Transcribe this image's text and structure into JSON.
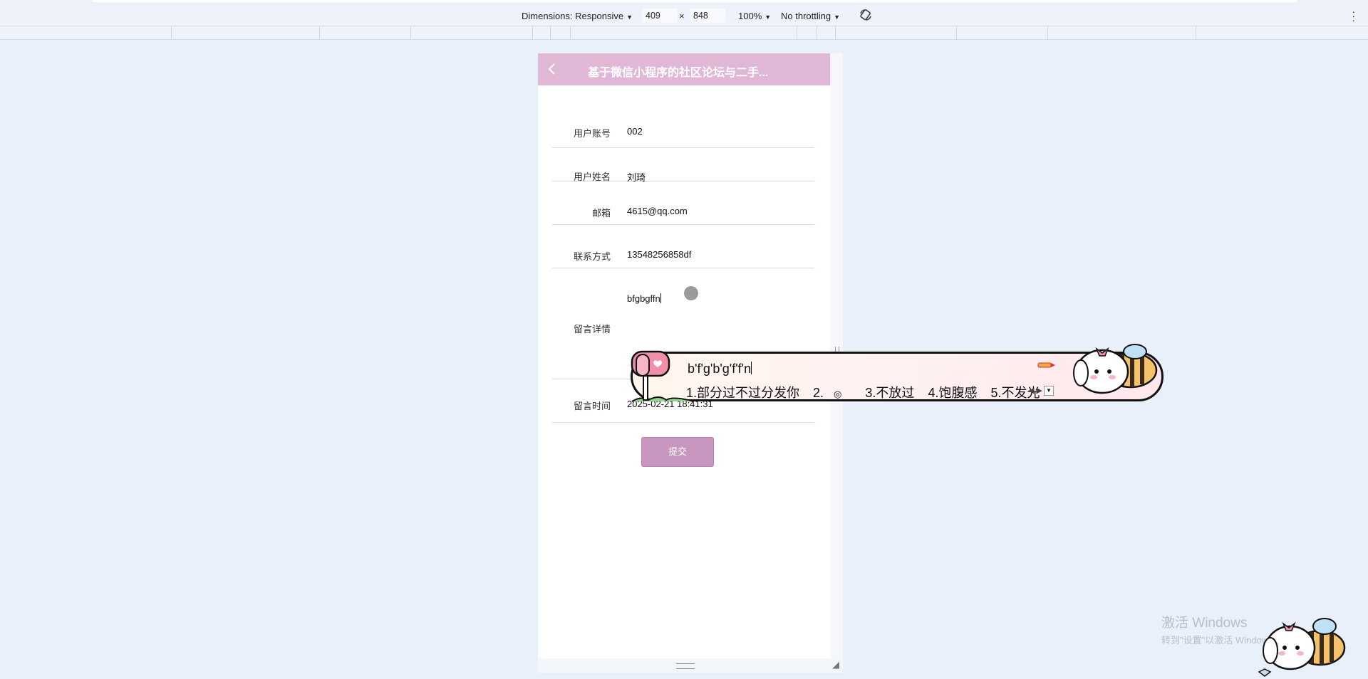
{
  "devtools": {
    "dimensions_label": "Dimensions: Responsive",
    "width": "409",
    "times": "×",
    "height": "848",
    "zoom": "100%",
    "throttling": "No throttling"
  },
  "app": {
    "nav_title": "基于微信小程序的社区论坛与二手...",
    "fields": [
      {
        "label": "用户账号",
        "value": "002"
      },
      {
        "label": "用户姓名",
        "value": "刘琦"
      },
      {
        "label": "邮箱",
        "value": "4615@qq.com"
      },
      {
        "label": "联系方式",
        "value": "13548256858df"
      },
      {
        "label": "留言详情",
        "value": "bfgbgffn"
      },
      {
        "label": "留言时间",
        "value": "2025-02-21 18:41:31"
      }
    ],
    "submit_label": "提交"
  },
  "ime": {
    "composition": "b'f'g'b'g'f'f'n",
    "candidates": [
      "1.部分过不过分发你",
      "2.",
      "3.不放过",
      "4.饱腹感",
      "5.不发光"
    ]
  },
  "watermark": {
    "line1": "激活 Windows",
    "line2": "转到\"设置\"以激活 Windows。"
  },
  "colors": {
    "nav_bg": "#e0b8d5",
    "submit_bg": "#c996c0",
    "page_bg": "#eaf0f9"
  }
}
